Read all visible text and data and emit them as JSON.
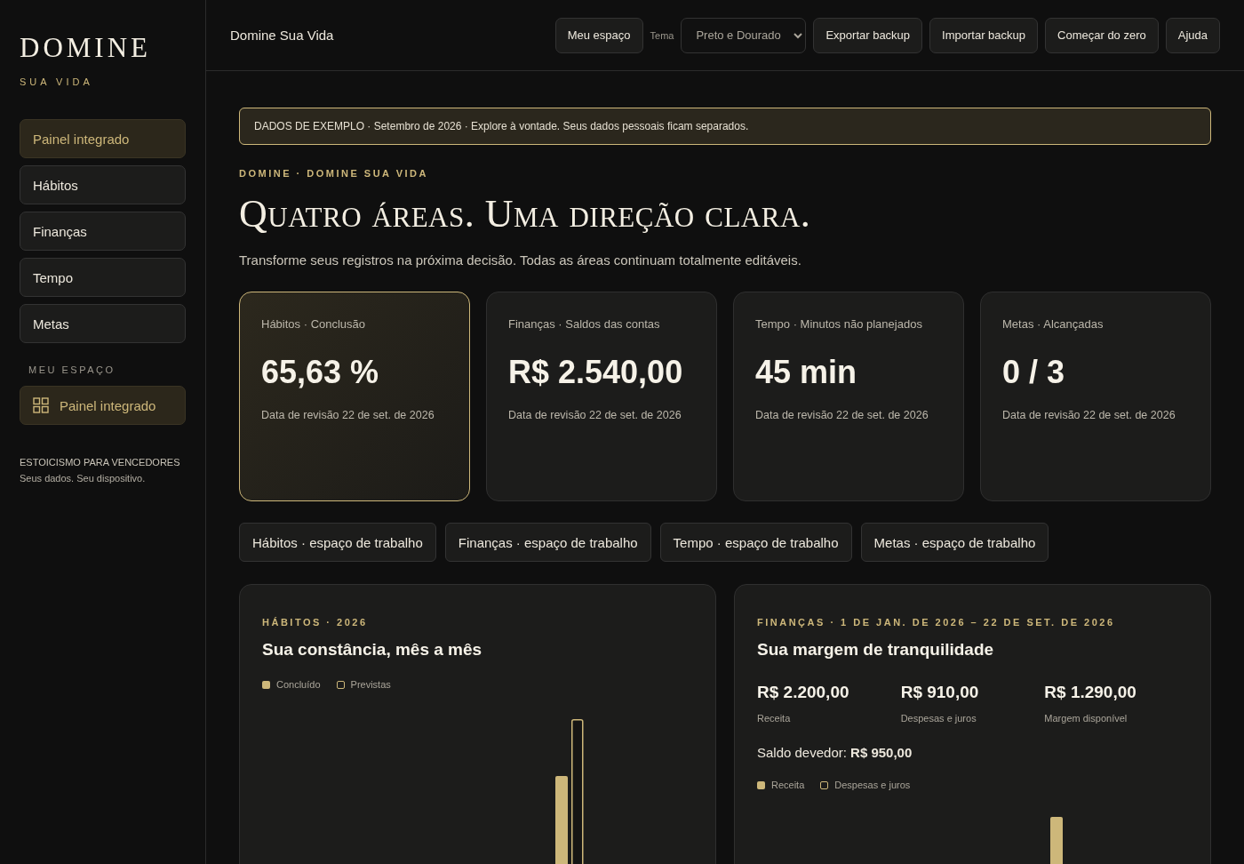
{
  "sidebar": {
    "logo": "DOMINE",
    "tagline": "SUA VIDA",
    "nav": [
      {
        "label": "Painel integrado",
        "selected": true
      },
      {
        "label": "Hábitos",
        "selected": false
      },
      {
        "label": "Finanças",
        "selected": false
      },
      {
        "label": "Tempo",
        "selected": false
      },
      {
        "label": "Metas",
        "selected": false
      }
    ],
    "section_label": "MEU ESPAÇO",
    "workspace_items": [
      {
        "label": "Painel integrado",
        "selected": true
      }
    ],
    "footer_title": "ESTOICISMO PARA VENCEDORES",
    "footer_text": "Seus dados. Seu dispositivo."
  },
  "header": {
    "title": "Domine Sua Vida",
    "space_button": "Meu espaço",
    "theme_label": "Tema",
    "theme_value": "Preto e Dourado",
    "buttons": [
      "Exportar backup",
      "Importar backup",
      "Começar do zero",
      "Ajuda"
    ]
  },
  "banner": "DADOS DE EXEMPLO · Setembro de 2026 · Explore à vontade. Seus dados pessoais ficam separados.",
  "eyebrow": "DOMINE · DOMINE SUA VIDA",
  "heading": "Quatro áreas. Uma direção clara.",
  "intro": "Transforme seus registros na próxima decisão. Todas as áreas continuam totalmente editáveis.",
  "stats": [
    {
      "label": "Hábitos · Conclusão",
      "value": "65,63 %",
      "note": "Data de revisão 22 de set. de 2026",
      "selected": true
    },
    {
      "label": "Finanças · Saldos das contas",
      "value": "R$ 2.540,00",
      "note": "Data de revisão 22 de set. de 2026",
      "selected": false
    },
    {
      "label": "Tempo · Minutos não planejados",
      "value": "45 min",
      "note": "Data de revisão 22 de set. de 2026",
      "selected": false
    },
    {
      "label": "Metas · Alcançadas",
      "value": "0 / 3",
      "note": "Data de revisão 22 de set. de 2026",
      "selected": false
    }
  ],
  "workspace_links": [
    "Hábitos · espaço de trabalho",
    "Finanças · espaço de trabalho",
    "Tempo · espaço de trabalho",
    "Metas · espaço de trabalho"
  ],
  "habits_panel": {
    "eyebrow": "HÁBITOS · 2026",
    "title": "Sua constância, mês a mês",
    "legend": [
      {
        "label": "Concluído",
        "kind": "filled"
      },
      {
        "label": "Previstas",
        "kind": "outline"
      }
    ]
  },
  "finance_panel": {
    "eyebrow": "FINANÇAS · 1 DE JAN. DE 2026 – 22 DE SET. DE 2026",
    "title": "Sua margem de tranquilidade",
    "figures": [
      {
        "value": "R$ 2.200,00",
        "label": "Receita"
      },
      {
        "value": "R$ 910,00",
        "label": "Despesas e juros"
      },
      {
        "value": "R$ 1.290,00",
        "label": "Margem disponível"
      }
    ],
    "debt": "Saldo devedor: **R$ 950,00**",
    "legend": [
      {
        "label": "Receita",
        "kind": "filled"
      },
      {
        "label": "Despesas e juros",
        "kind": "outline"
      }
    ]
  }
}
